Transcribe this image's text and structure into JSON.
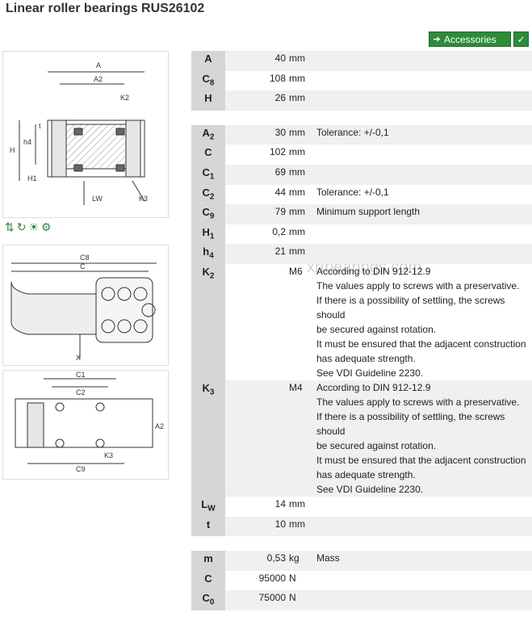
{
  "title": "Linear roller bearings RUS26102",
  "accessories_label": "Accessories",
  "watermark": "xrtbearings.com",
  "groups": [
    [
      {
        "label": "A",
        "sub": "",
        "value": "40",
        "unit": "mm",
        "note": []
      },
      {
        "label": "C",
        "sub": "8",
        "value": "108",
        "unit": "mm",
        "note": []
      },
      {
        "label": "H",
        "sub": "",
        "value": "26",
        "unit": "mm",
        "note": []
      }
    ],
    [
      {
        "label": "A",
        "sub": "2",
        "value": "30",
        "unit": "mm",
        "note": [
          "Tolerance: +/-0,1"
        ]
      },
      {
        "label": "C",
        "sub": "",
        "value": "102",
        "unit": "mm",
        "note": []
      },
      {
        "label": "C",
        "sub": "1",
        "value": "69",
        "unit": "mm",
        "note": []
      },
      {
        "label": "C",
        "sub": "2",
        "value": "44",
        "unit": "mm",
        "note": [
          "Tolerance: +/-0,1"
        ]
      },
      {
        "label": "C",
        "sub": "9",
        "value": "79",
        "unit": "mm",
        "note": [
          "Minimum support length"
        ]
      },
      {
        "label": "H",
        "sub": "1",
        "value": "0,2",
        "unit": "mm",
        "note": []
      },
      {
        "label": "h",
        "sub": "4",
        "value": "21",
        "unit": "mm",
        "note": []
      },
      {
        "label": "K",
        "sub": "2",
        "value": "",
        "unit": "M6",
        "note": [
          "According to DIN 912-12.9",
          "The values apply to screws with a preservative.",
          "If there is a possibility of settling, the screws should",
          "be secured against rotation.",
          "It must be ensured that the adjacent construction",
          "has adequate strength.",
          "See VDI Guideline 2230."
        ]
      },
      {
        "label": "K",
        "sub": "3",
        "value": "",
        "unit": "M4",
        "note": [
          "According to DIN 912-12.9",
          "The values apply to screws with a preservative.",
          "If there is a possibility of settling, the screws should",
          "be secured against rotation.",
          "It must be ensured that the adjacent construction",
          "has adequate strength.",
          "See VDI Guideline 2230."
        ]
      },
      {
        "label": "L",
        "sub": "W",
        "value": "14",
        "unit": "mm",
        "note": []
      },
      {
        "label": "t",
        "sub": "",
        "value": "10",
        "unit": "mm",
        "note": []
      }
    ],
    [
      {
        "label": "m",
        "sub": "",
        "value": "0,53",
        "unit": "kg",
        "note": [
          "Mass"
        ]
      },
      {
        "label": "C",
        "sub": "",
        "value": "95000",
        "unit": "N",
        "note": []
      },
      {
        "label": "C",
        "sub": "0",
        "value": "75000",
        "unit": "N",
        "note": []
      }
    ]
  ],
  "drawing_labels": {
    "top": [
      "A",
      "A2",
      "K2",
      "H",
      "h4",
      "t",
      "H1",
      "LW",
      "K3"
    ],
    "mid": [
      "C8",
      "C",
      "X"
    ],
    "bot": [
      "C1",
      "C2",
      "A2",
      "C9",
      "K3"
    ]
  }
}
